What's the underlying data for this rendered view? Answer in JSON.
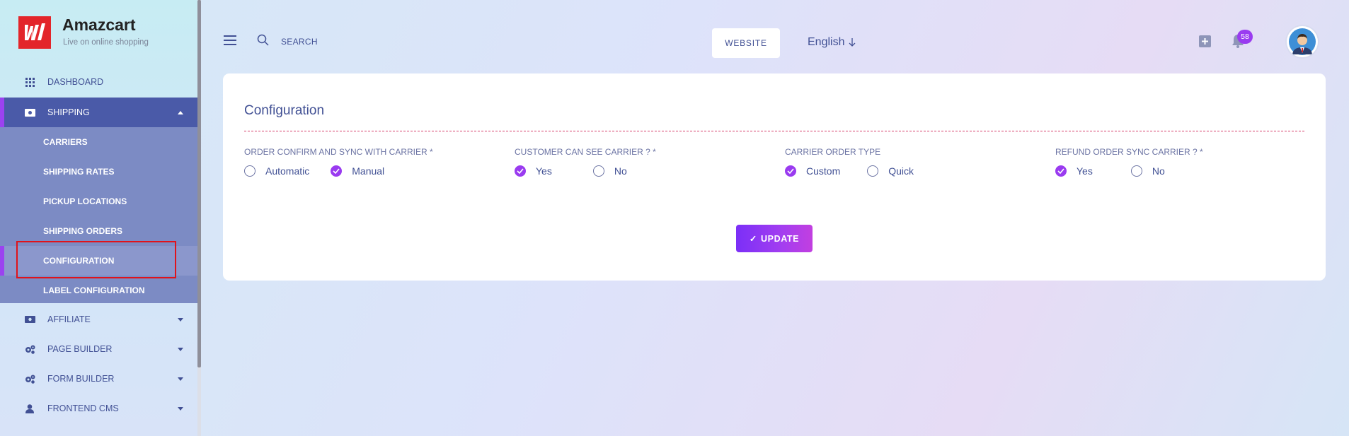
{
  "brand": {
    "name": "Amazcart",
    "tagline": "Live on online shopping"
  },
  "sidebar": {
    "items": [
      {
        "label": "DASHBOARD",
        "icon": "grid-icon"
      },
      {
        "label": "SHIPPING",
        "icon": "shipping-icon"
      },
      {
        "label": "AFFILIATE",
        "icon": "money-icon"
      },
      {
        "label": "PAGE BUILDER",
        "icon": "gears-icon"
      },
      {
        "label": "FORM BUILDER",
        "icon": "gears-icon"
      },
      {
        "label": "FRONTEND CMS",
        "icon": "user-icon"
      }
    ],
    "shipping_submenu": [
      {
        "label": "CARRIERS"
      },
      {
        "label": "SHIPPING RATES"
      },
      {
        "label": "PICKUP LOCATIONS"
      },
      {
        "label": "SHIPPING ORDERS"
      },
      {
        "label": "CONFIGURATION"
      },
      {
        "label": "LABEL CONFIGURATION"
      }
    ]
  },
  "topbar": {
    "search_label": "SEARCH",
    "website_button": "WEBSITE",
    "language": "English",
    "notification_count": "58"
  },
  "card": {
    "title": "Configuration",
    "fields": [
      {
        "label": "ORDER CONFIRM AND SYNC WITH CARRIER *",
        "options": [
          "Automatic",
          "Manual"
        ],
        "selected": "Manual"
      },
      {
        "label": "CUSTOMER CAN SEE CARRIER ? *",
        "options": [
          "Yes",
          "No"
        ],
        "selected": "Yes"
      },
      {
        "label": "CARRIER ORDER TYPE",
        "options": [
          "Custom",
          "Quick"
        ],
        "selected": "Custom"
      },
      {
        "label": "REFUND ORDER SYNC CARRIER ? *",
        "options": [
          "Yes",
          "No"
        ],
        "selected": "Yes"
      }
    ],
    "update_button": "UPDATE"
  },
  "colors": {
    "accent": "#9a3bf0",
    "primary_text": "#415094",
    "highlight": "#e0131b"
  }
}
